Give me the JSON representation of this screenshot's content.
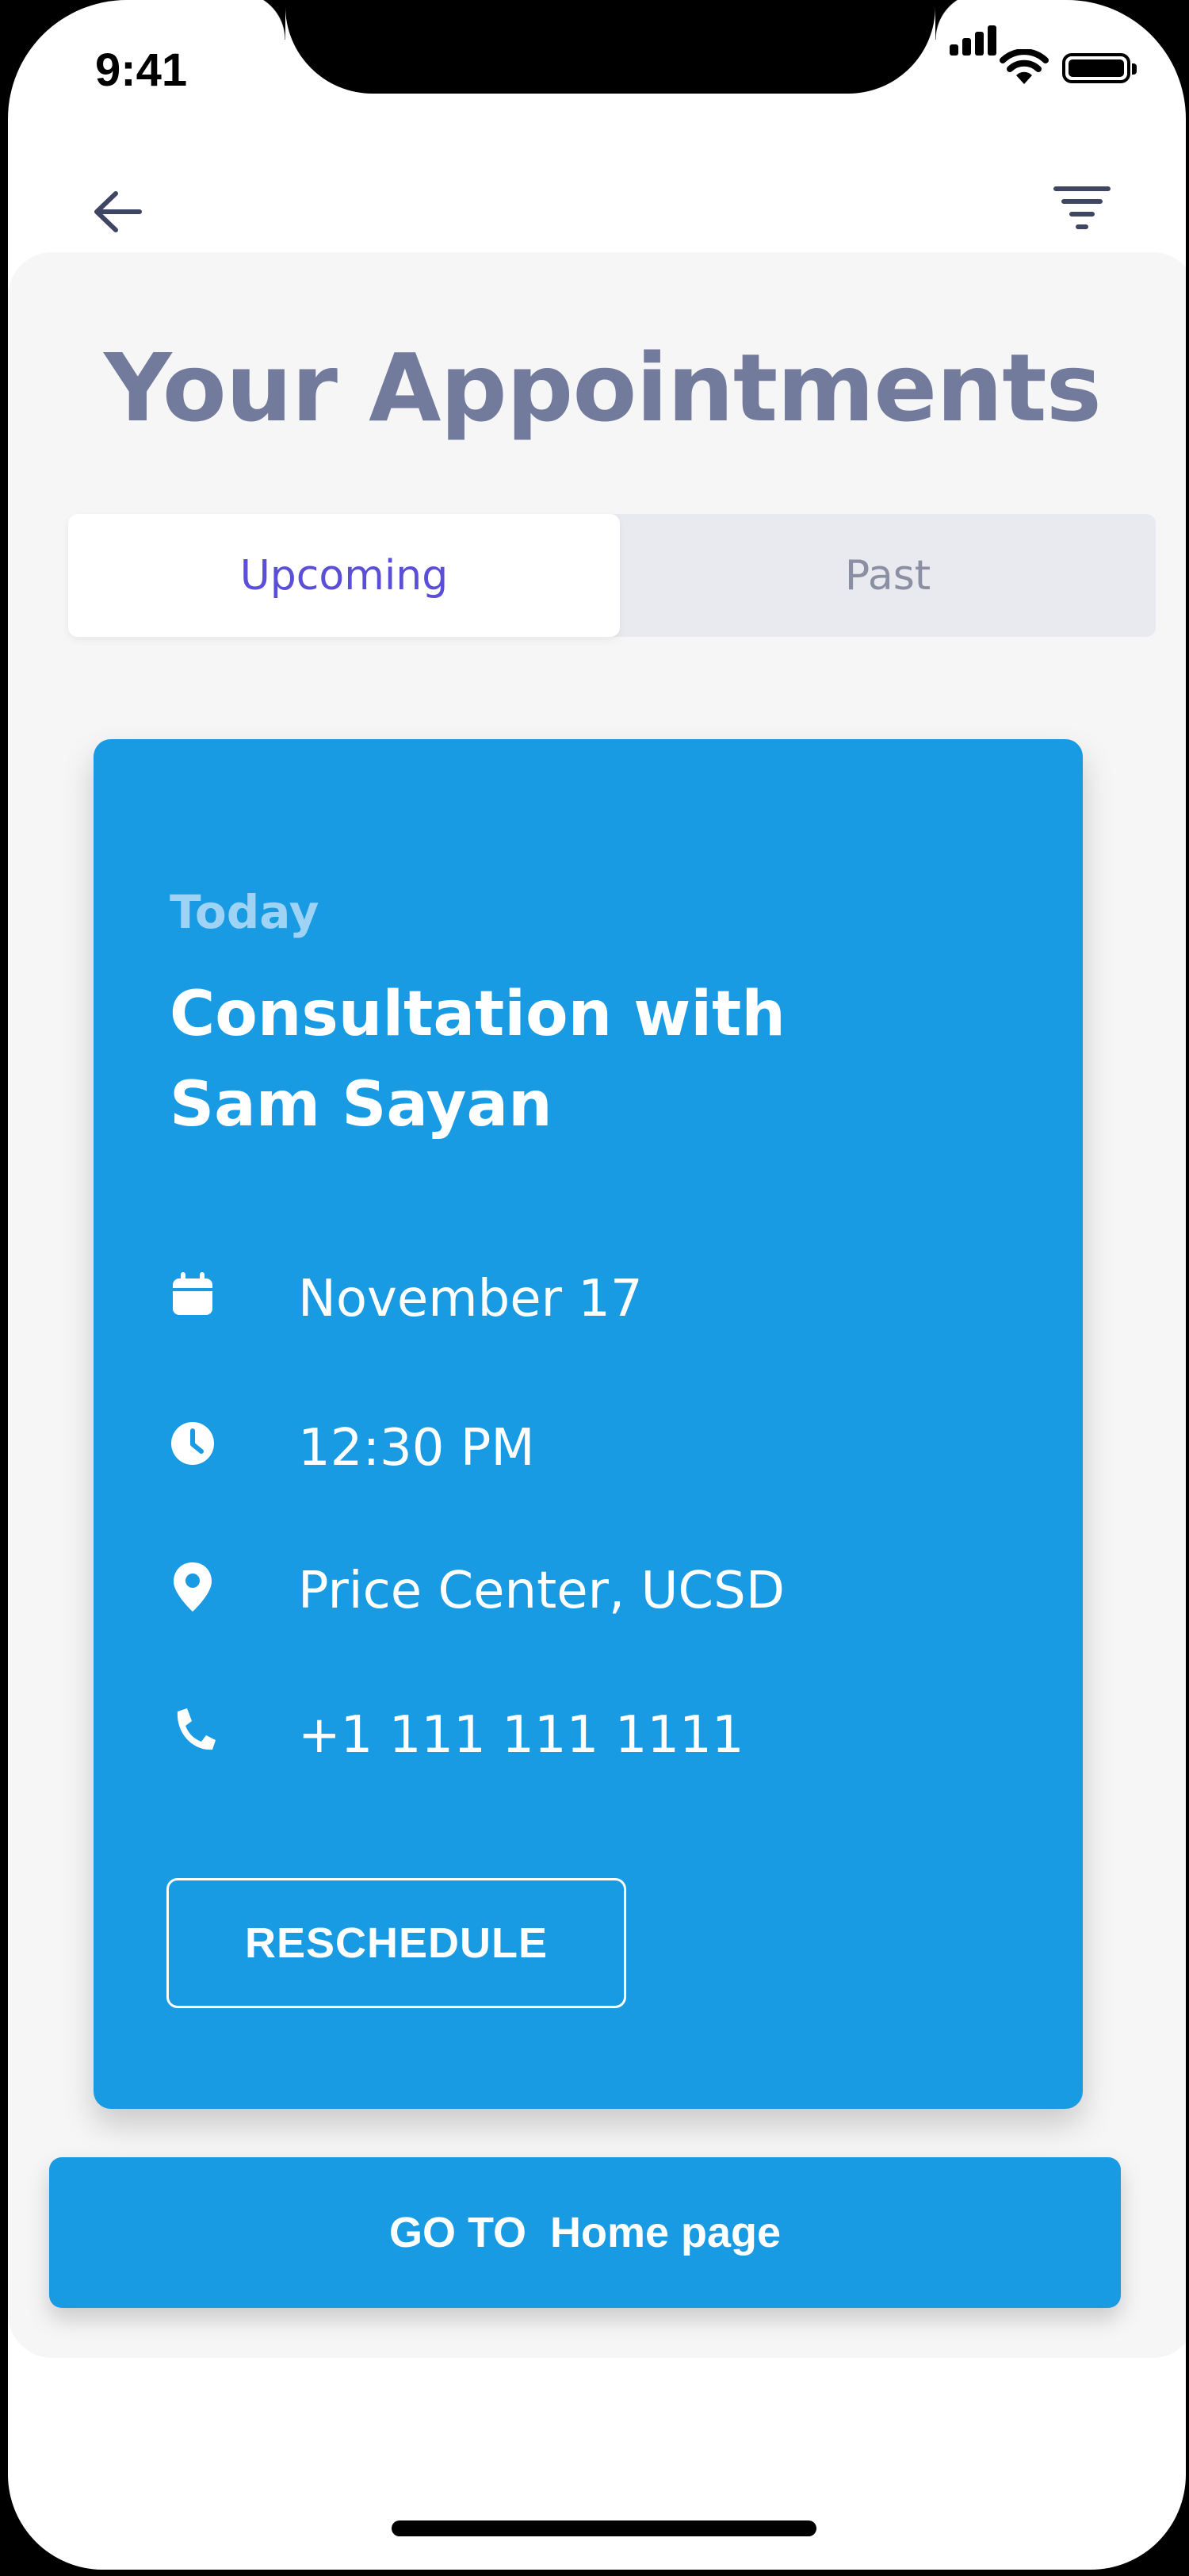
{
  "status_bar": {
    "time": "9:41"
  },
  "header": {
    "back_icon": "arrow-left-icon",
    "filter_icon": "filter-icon"
  },
  "page": {
    "title": "Your Appointments"
  },
  "tabs": [
    {
      "label": "Upcoming",
      "active": true
    },
    {
      "label": "Past",
      "active": false
    }
  ],
  "appointment": {
    "day": "Today",
    "title_line1": "Consultation with",
    "title_line2": "Sam Sayan",
    "date": "November 17",
    "time": "12:30 PM",
    "location": "Price Center, UCSD",
    "phone": "+1 111 111 1111",
    "reschedule_label": "RESCHEDULE"
  },
  "footer": {
    "home_button_label": "GO TO  Home page"
  },
  "colors": {
    "accent_blue": "#199be4",
    "title_gray": "#737b9c",
    "active_tab_text": "#5a4fd6",
    "panel_bg": "#f6f6f7"
  }
}
